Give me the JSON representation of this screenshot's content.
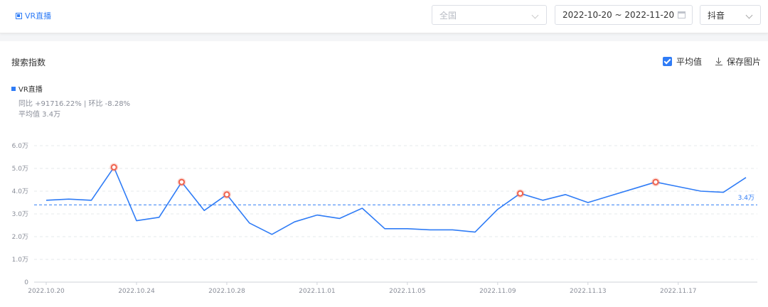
{
  "header": {
    "keyword": "VR直播",
    "region": {
      "value": "全国"
    },
    "date_range": {
      "value": "2022-10-20 ~ 2022-11-20"
    },
    "platform": {
      "value": "抖音"
    }
  },
  "panel": {
    "title": "搜索指数",
    "avg_toggle_label": "平均值",
    "save_label": "保存图片",
    "legend_label": "VR直播",
    "stats_text": "同比 +91716.22% | 环比 -8.28%",
    "avg_text": "平均值 3.4万"
  },
  "colors": {
    "series": "#2f7cf6",
    "highlight": "#f0624d",
    "grid": "#e6e8eb"
  },
  "chart_data": {
    "type": "line",
    "title": "",
    "xlabel": "",
    "ylabel": "",
    "x": [
      "2022.10.20",
      "2022.10.21",
      "2022.10.22",
      "2022.10.23",
      "2022.10.24",
      "2022.10.25",
      "2022.10.26",
      "2022.10.27",
      "2022.10.28",
      "2022.10.29",
      "2022.10.30",
      "2022.10.31",
      "2022.11.01",
      "2022.11.02",
      "2022.11.03",
      "2022.11.04",
      "2022.11.05",
      "2022.11.06",
      "2022.11.07",
      "2022.11.08",
      "2022.11.09",
      "2022.11.10",
      "2022.11.11",
      "2022.11.12",
      "2022.11.13",
      "2022.11.14",
      "2022.11.15",
      "2022.11.16",
      "2022.11.17",
      "2022.11.18",
      "2022.11.19",
      "2022.11.20"
    ],
    "x_ticks": [
      "2022.10.20",
      "2022.10.24",
      "2022.10.28",
      "2022.11.01",
      "2022.11.05",
      "2022.11.09",
      "2022.11.13",
      "2022.11.17"
    ],
    "series": [
      {
        "name": "VR直播",
        "values": [
          3.6,
          3.65,
          3.6,
          5.05,
          2.7,
          2.85,
          4.4,
          3.15,
          3.85,
          2.6,
          2.1,
          2.65,
          2.95,
          2.8,
          3.25,
          2.35,
          2.35,
          2.3,
          2.3,
          2.2,
          3.2,
          3.9,
          3.6,
          3.85,
          3.5,
          3.8,
          4.1,
          4.4,
          4.2,
          4.0,
          3.95,
          4.6
        ]
      }
    ],
    "highlight_points": [
      "2022.10.23",
      "2022.10.26",
      "2022.10.28",
      "2022.11.10",
      "2022.11.16"
    ],
    "average": 3.4,
    "average_label": "3.4万",
    "ylim": [
      0,
      6
    ],
    "y_ticks": [
      {
        "value": 0,
        "label": "0"
      },
      {
        "value": 1,
        "label": "1.0万"
      },
      {
        "value": 2,
        "label": "2.0万"
      },
      {
        "value": 3,
        "label": "3.0万"
      },
      {
        "value": 4,
        "label": "4.0万"
      },
      {
        "value": 5,
        "label": "5.0万"
      },
      {
        "value": 6,
        "label": "6.0万"
      }
    ],
    "grid": true
  }
}
